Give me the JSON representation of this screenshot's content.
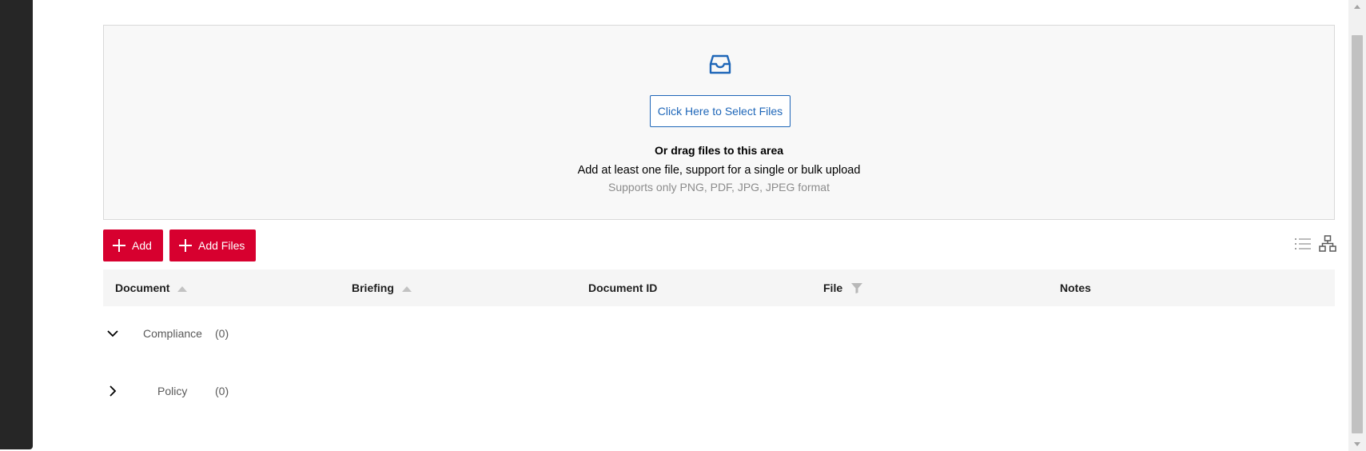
{
  "upload": {
    "select_button": "Click Here to Select Files",
    "title": "Or drag files to this area",
    "hint": "Add at least one file, support for a single or bulk upload",
    "formats": "Supports only PNG, PDF, JPG, JPEG format"
  },
  "toolbar": {
    "add_label": "Add",
    "add_files_label": "Add Files"
  },
  "table": {
    "columns": [
      {
        "label": "Document",
        "sort": "asc"
      },
      {
        "label": "Briefing",
        "sort": "asc"
      },
      {
        "label": "Document ID"
      },
      {
        "label": "File",
        "filter": true
      },
      {
        "label": "Notes"
      }
    ],
    "groups": [
      {
        "name": "Compliance",
        "count": "(0)",
        "expanded": true
      },
      {
        "name": "Policy",
        "count": "(0)",
        "expanded": false
      }
    ]
  },
  "colors": {
    "accent_red": "#d7002f",
    "link_blue": "#1e66b8",
    "sidebar_dark": "#262626"
  },
  "icons": {
    "upload": "inbox-icon",
    "list_view": "list-view-icon",
    "tree_view": "tree-view-icon"
  }
}
